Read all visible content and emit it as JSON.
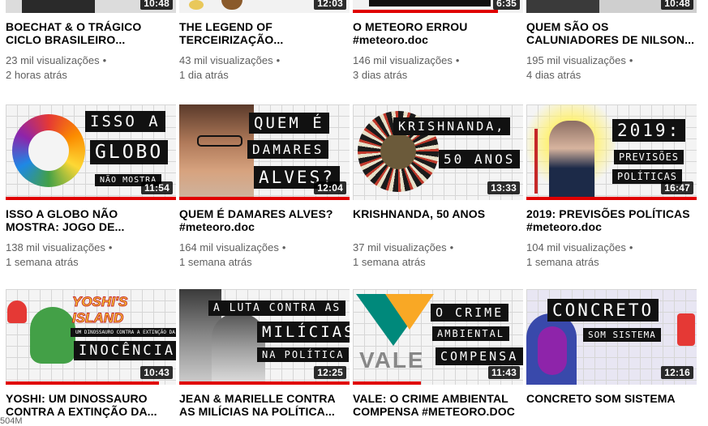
{
  "videos": [
    {
      "title_1": "BOECHAT & O TRÁGICO",
      "title_2": "CICLO BRASILEIRO...",
      "views": "23 mil visualizações",
      "age": "2 horas atrás",
      "duration": "10:48",
      "progress": 0
    },
    {
      "title_1": "THE LEGEND OF",
      "title_2": "TERCEIRIZAÇÃO...",
      "views": "43 mil visualizações",
      "age": "1 dia atrás",
      "duration": "12:03",
      "progress": 0
    },
    {
      "title_1": "O METEORO ERROU",
      "title_2": "#meteoro.doc",
      "views": "146 mil visualizações",
      "age": "3 dias atrás",
      "duration": "6:35",
      "progress": 0.85
    },
    {
      "title_1": "QUEM SÃO OS",
      "title_2": "CALUNIADORES DE NILSON...",
      "views": "195 mil visualizações",
      "age": "4 dias atrás",
      "duration": "10:48",
      "progress": 0
    },
    {
      "title_1": "ISSO A GLOBO NÃO",
      "title_2": "MOSTRA: JOGO DE...",
      "views": "138 mil visualizações",
      "age": "1 semana atrás",
      "duration": "11:54",
      "progress": 1,
      "thumb_lines": [
        "ISSO A",
        "GLOBO",
        "NÃO MOSTRA"
      ]
    },
    {
      "title_1": "QUEM É DAMARES ALVES?",
      "title_2": "#meteoro.doc",
      "views": "164 mil visualizações",
      "age": "1 semana atrás",
      "duration": "12:04",
      "progress": 1,
      "thumb_lines": [
        "QUEM É",
        "DAMARES",
        "ALVES?"
      ]
    },
    {
      "title_1": "KRISHNANDA, 50 ANOS",
      "title_2": "",
      "views": "37 mil visualizações",
      "age": "1 semana atrás",
      "duration": "13:33",
      "progress": 0,
      "thumb_lines": [
        "KRISHNANDA,",
        "50 ANOS"
      ]
    },
    {
      "title_1": "2019: PREVISÕES POLÍTICAS",
      "title_2": "#meteoro.doc",
      "views": "104 mil visualizações",
      "age": "1 semana atrás",
      "duration": "16:47",
      "progress": 1,
      "thumb_lines": [
        "2019:",
        "PREVISÕES",
        "POLÍTICAS"
      ]
    },
    {
      "title_1": "YOSHI: UM DINOSSAURO",
      "title_2": "CONTRA A EXTINÇÃO DA...",
      "views": "",
      "age": "",
      "duration": "10:43",
      "progress": 0.9,
      "thumb_lines": [
        "YOSHI'S ISLAND",
        "UM DINOSSAURO CONTRA A EXTINÇÃO DA",
        "INOCÊNCIA"
      ]
    },
    {
      "title_1": "JEAN & MARIELLE CONTRA",
      "title_2": "AS MILÍCIAS NA POLÍTICA...",
      "views": "",
      "age": "",
      "duration": "12:25",
      "progress": 1,
      "thumb_lines": [
        "A LUTA CONTRA AS",
        "MILÍCIAS",
        "NA POLÍTICA"
      ]
    },
    {
      "title_1": "VALE: O CRIME AMBIENTAL",
      "title_2": "COMPENSA #meteoro.doc",
      "views": "",
      "age": "",
      "duration": "11:43",
      "progress": 0.4,
      "thumb_lines": [
        "O CRIME",
        "AMBIENTAL",
        "COMPENSA",
        "VALE"
      ]
    },
    {
      "title_1": "CONCRETO SOM SISTEMA",
      "title_2": "",
      "views": "",
      "age": "",
      "duration": "12:16",
      "progress": 0,
      "thumb_lines": [
        "CONCRETO",
        "SOM SISTEMA"
      ]
    }
  ],
  "footer_fragment": "504M",
  "colors": {
    "progress": "#e00000",
    "title": "#030303",
    "meta": "#606060",
    "badge_bg": "#000000"
  }
}
